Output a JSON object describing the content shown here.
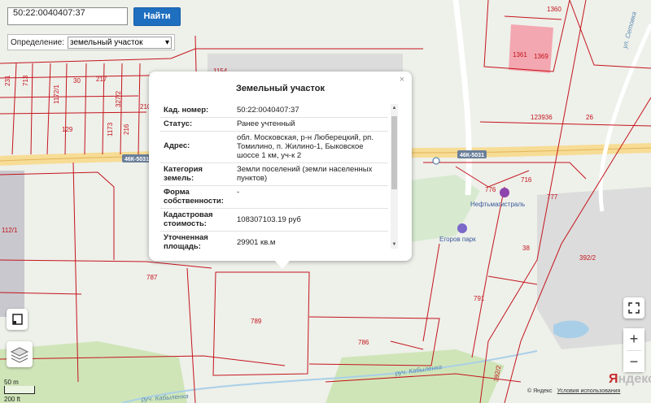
{
  "search": {
    "value": "50:22:0040407:37",
    "button_label": "Найти"
  },
  "definition": {
    "label": "Определение:",
    "selected": "земельный участок"
  },
  "popup": {
    "title": "Земельный участок",
    "close": "×",
    "rows": [
      {
        "key": "Кад. номер:",
        "value": "50:22:0040407:37"
      },
      {
        "key": "Статус:",
        "value": "Ранее учтенный"
      },
      {
        "key": "Адрес:",
        "value": "обл. Московская, р-н Люберецкий, рп. Томилино, п. Жилино-1, Быковское шоссе 1 км, уч-к 2"
      },
      {
        "key": "Категория земель:",
        "value": "Земли поселений (земли населенных пунктов)"
      },
      {
        "key": "Форма собственности:",
        "value": "-"
      },
      {
        "key": "Кадастровая стоимость:",
        "value": "108307103.19 руб"
      },
      {
        "key": "Уточненная площадь:",
        "value": "29901 кв.м"
      }
    ]
  },
  "map_labels": {
    "parcels": [
      "1360",
      "1361",
      "1369",
      "1154",
      "123936",
      "26",
      "777",
      "776",
      "716",
      "38",
      "392/2",
      "791",
      "787",
      "789",
      "786",
      "112/1",
      "231",
      "713",
      "30",
      "217",
      "1172/1",
      "1173",
      "327/2",
      "216",
      "210",
      "129",
      "392/2"
    ],
    "roads": [
      "46К-5031",
      "46К-5031"
    ],
    "streams": [
      "руч. Кабыленка",
      "руч. Кабыленка"
    ],
    "street": "ул. Сетовка",
    "pois": [
      "Нефтьмагистраль",
      "Егоров парк"
    ]
  },
  "controls": {
    "zoom_in": "+",
    "zoom_out": "−"
  },
  "scale": {
    "meters": "50 m",
    "feet": "200 ft"
  },
  "copyright": {
    "text": "© Яндекс",
    "link": "Условия использования"
  },
  "logo": {
    "y": "Я",
    "rest": "ндекс"
  },
  "colors": {
    "parcel_line": "#c4141c",
    "road": "#f7dc95",
    "button": "#1f6fc0"
  }
}
